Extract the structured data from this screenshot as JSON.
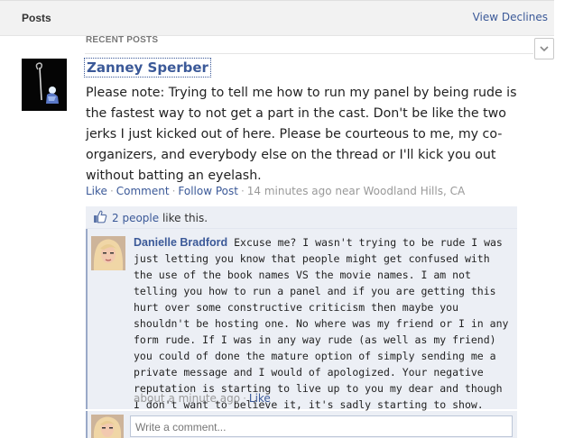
{
  "header": {
    "title": "Posts",
    "view_declines": "View Declines"
  },
  "recent_posts_label": "RECENT POSTS",
  "post": {
    "author": "Zanney Sperber",
    "body": "Please note: Trying to tell me how to run my panel by being rude is the fastest way to not get a part in the cast. Don't be like the two jerks I just kicked out of here. Please be courteous to me, my co-organizers, and everybody else on the thread or I'll kick you out without batting an eyelash.",
    "actions": {
      "like": "Like",
      "comment": "Comment",
      "follow": "Follow Post"
    },
    "time": "14 minutes ago",
    "location_prefix": "near",
    "location": "Woodland Hills, CA"
  },
  "likes": {
    "count_link": "2 people",
    "suffix": "like this."
  },
  "comment": {
    "author": "Danielle Bradford",
    "text": "Excuse me? I wasn't trying to be rude I was just letting you know that people might get confused with the use of the book names VS the movie names. I am not telling you how to run a panel and if you are getting this hurt over some constructive criticism then maybe you shouldn't be hosting one. No where was my friend or I in any form rude. If I was in any way rude (as well as my friend) you could of done the mature option of simply sending me a private message and I would of apologized. Your negative reputation is starting to live up to you my dear and though I don't want to believe it, it's sadly starting to show.",
    "time": "about a minute ago",
    "like": "Like"
  },
  "write_comment": {
    "placeholder": "Write a comment..."
  },
  "icons": {
    "dropdown": "chevron-down-icon",
    "likes": "thumbs-up-icon"
  },
  "colors": {
    "link": "#3b5998",
    "comment_bg": "#eceff5"
  }
}
